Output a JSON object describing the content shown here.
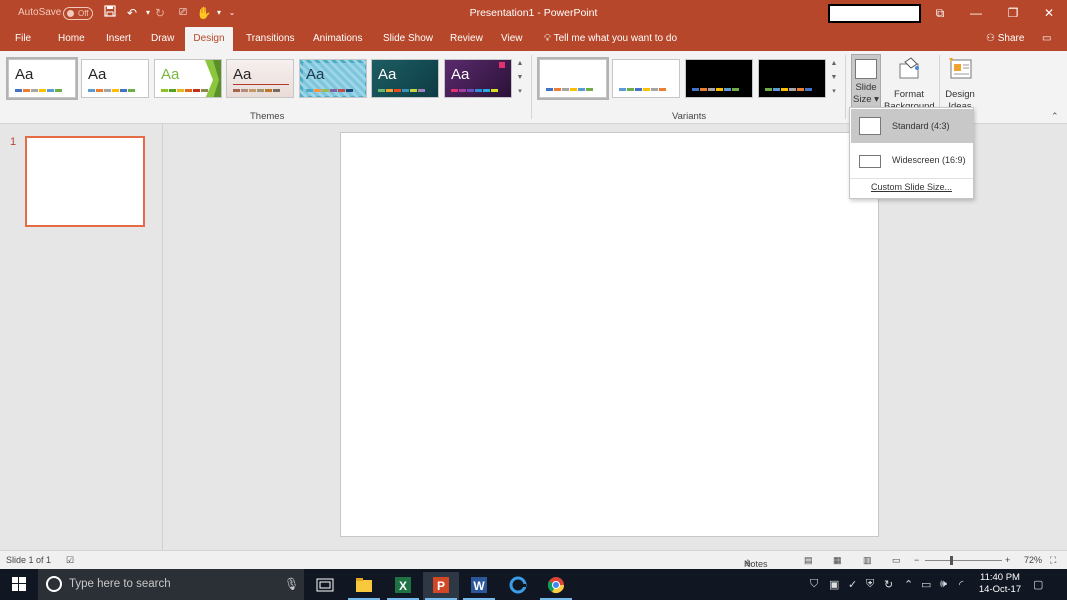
{
  "window": {
    "title": "Presentation1  -  PowerPoint",
    "autosave_label": "AutoSave",
    "autosave_state": "Off"
  },
  "tabs": [
    "File",
    "Home",
    "Insert",
    "Draw",
    "Design",
    "Transitions",
    "Animations",
    "Slide Show",
    "Review",
    "View"
  ],
  "active_tab": "Design",
  "tell_me": "Tell me what you want to do",
  "share_label": "Share",
  "ribbon": {
    "themes_label": "Themes",
    "theme_sample_text": "Aa",
    "variants_label": "Variants",
    "slide_size": "Slide\nSize",
    "slide_size_line1": "Slide",
    "slide_size_line2": "Size",
    "format_bg_line1": "Format",
    "format_bg_line2": "Background",
    "design_ideas_line1": "Design",
    "design_ideas_line2": "Ideas"
  },
  "dropdown": {
    "items": [
      "Standard (4:3)",
      "Widescreen (16:9)"
    ],
    "highlighted": "Standard (4:3)",
    "custom": "Custom Slide Size..."
  },
  "thumbnails": [
    {
      "number": "1"
    }
  ],
  "status": {
    "slide_info": "Slide 1 of 1",
    "notes": "Notes",
    "zoom": "72%"
  },
  "taskbar": {
    "search_placeholder": "Type here to search",
    "time": "11:40 PM",
    "date": "14-Oct-17"
  },
  "colors": {
    "accent": "#b7472a",
    "selection": "#e46b46"
  }
}
